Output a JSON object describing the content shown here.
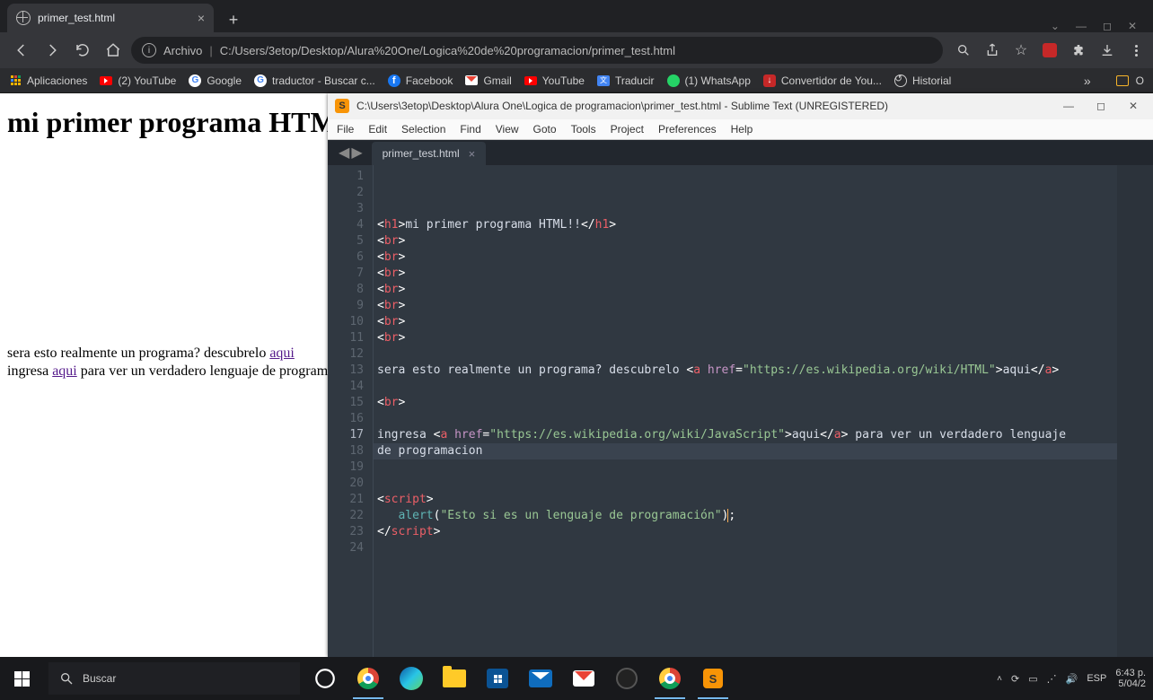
{
  "chrome": {
    "tab_title": "primer_test.html",
    "addr_label": "Archivo",
    "url": "C:/Users/3etop/Desktop/Alura%20One/Logica%20de%20programacion/primer_test.html",
    "bookmarks": {
      "apps": "Aplicaciones",
      "youtube": "(2) YouTube",
      "google": "Google",
      "traductor": "traductor - Buscar c...",
      "facebook": "Facebook",
      "gmail": "Gmail",
      "youtube2": "YouTube",
      "traducir": "Traducir",
      "whatsapp": "(1) WhatsApp",
      "convertidor": "Convertidor de You...",
      "historial": "Historial",
      "other": "O"
    }
  },
  "page": {
    "h1": "mi primer programa HTML!",
    "line1_pre": "sera esto realmente un programa? descubrelo ",
    "line1_link": "aqui",
    "line2_pre": "ingresa ",
    "line2_link": "aqui",
    "line2_post": " para ver un verdadero lenguaje de programacion"
  },
  "sublime": {
    "title": "C:\\Users\\3etop\\Desktop\\Alura One\\Logica de programacion\\primer_test.html - Sublime Text (UNREGISTERED)",
    "menu": [
      "File",
      "Edit",
      "Selection",
      "Find",
      "View",
      "Goto",
      "Tools",
      "Project",
      "Preferences",
      "Help"
    ],
    "tab": "primer_test.html",
    "gutter": [
      "1",
      "2",
      "3",
      "4",
      "5",
      "6",
      "7",
      "8",
      "9",
      "10",
      "11",
      "12",
      "13",
      "14",
      "",
      "15",
      "16",
      "17",
      "18",
      "19",
      "20",
      "21",
      "22",
      "23",
      "24"
    ],
    "current_line_index": 18,
    "code": {
      "l1_tag": "h1",
      "l1_text": "mi primer programa HTML!!",
      "br": "br",
      "l10_text": "sera esto realmente un programa? descubrelo ",
      "a": "a",
      "href": "href",
      "url1": "\"https://es.wikipedia.org/wiki/HTML\"",
      "aqui": "aqui",
      "l14_pre": "ingresa ",
      "url2": "\"https://es.wikipedia.org/wiki/JavaScript\"",
      "l14_post": " para ver un verdadero lenguaje ",
      "l14_wrap": "de programacion",
      "script": "script",
      "alert": "alert",
      "alert_str": "\"Esto si es un lenguaje de programación\""
    }
  },
  "taskbar": {
    "search_placeholder": "Buscar",
    "lang": "ESP",
    "time": "6:43 p.",
    "date": "5/04/2"
  }
}
